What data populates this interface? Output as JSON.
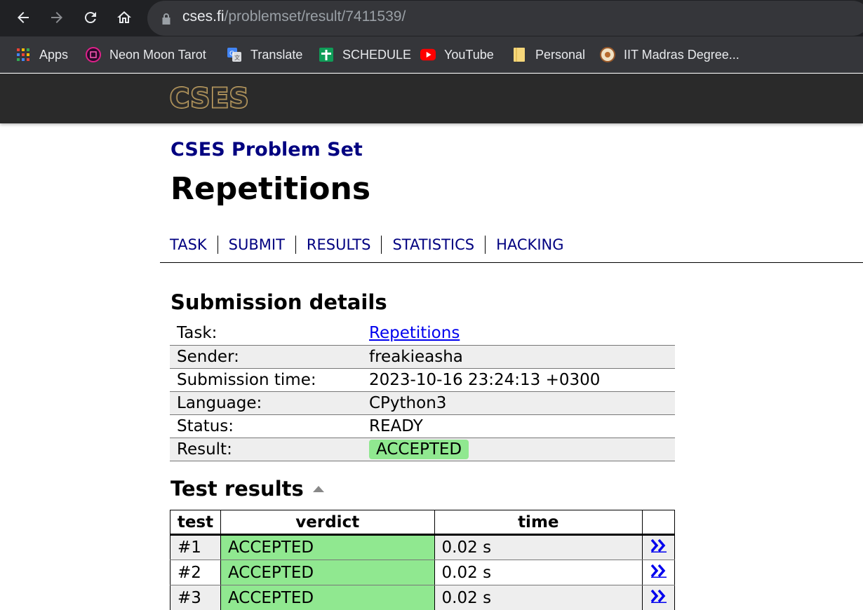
{
  "browser": {
    "url_host": "cses.fi",
    "url_path": "/problemset/result/7411539/",
    "bookmarks": [
      {
        "label": "Apps",
        "icon": "apps-grid-icon"
      },
      {
        "label": "Neon Moon Tarot",
        "icon": "neon-moon-icon"
      },
      {
        "label": "Translate",
        "icon": "google-translate-icon"
      },
      {
        "label": "SCHEDULE",
        "icon": "sheets-icon"
      },
      {
        "label": "YouTube",
        "icon": "youtube-icon"
      },
      {
        "label": "Personal",
        "icon": "folder-icon"
      },
      {
        "label": "IIT Madras Degree...",
        "icon": "iit-madras-icon"
      }
    ]
  },
  "site": {
    "logo_text": "CSES"
  },
  "page": {
    "subtitle": "CSES Problem Set",
    "title": "Repetitions",
    "nav": [
      "TASK",
      "SUBMIT",
      "RESULTS",
      "STATISTICS",
      "HACKING"
    ]
  },
  "details": {
    "heading": "Submission details",
    "rows": [
      {
        "key": "Task:",
        "value": "Repetitions"
      },
      {
        "key": "Sender:",
        "value": "freakieasha"
      },
      {
        "key": "Submission time:",
        "value": "2023-10-16 23:24:13 +0300"
      },
      {
        "key": "Language:",
        "value": "CPython3"
      },
      {
        "key": "Status:",
        "value": "READY"
      },
      {
        "key": "Result:",
        "value": "ACCEPTED"
      }
    ]
  },
  "tests": {
    "heading": "Test results",
    "columns": [
      "test",
      "verdict",
      "time"
    ],
    "rows": [
      {
        "test": "#1",
        "verdict": "ACCEPTED",
        "time": "0.02 s"
      },
      {
        "test": "#2",
        "verdict": "ACCEPTED",
        "time": "0.02 s"
      },
      {
        "test": "#3",
        "verdict": "ACCEPTED",
        "time": "0.02 s"
      }
    ]
  },
  "colors": {
    "chrome_dark": "#202124",
    "bookmark_bar": "#35363a",
    "header_bg": "#2a2a2a",
    "nav_link": "#000080",
    "accepted_green": "#90e890",
    "link_blue": "#0000ee"
  }
}
